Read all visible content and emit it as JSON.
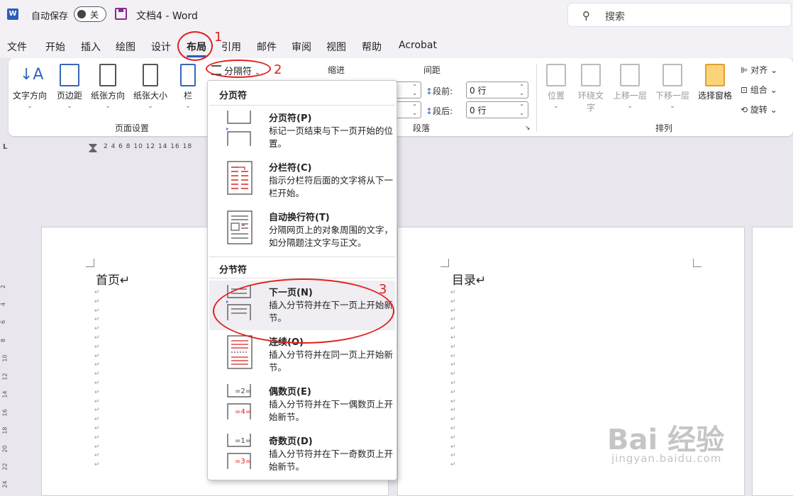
{
  "titlebar": {
    "autosave_label": "自动保存",
    "autosave_state": "关",
    "doc_title": "文档4  -  Word",
    "search_placeholder": "搜索"
  },
  "tabs": [
    "文件",
    "开始",
    "插入",
    "绘图",
    "设计",
    "布局",
    "引用",
    "邮件",
    "审阅",
    "视图",
    "帮助",
    "Acrobat"
  ],
  "active_tab": "布局",
  "ribbon": {
    "page_setup": {
      "group_label": "页面设置",
      "buttons": [
        "文字方向",
        "页边距",
        "纸张方向",
        "纸张大小",
        "栏"
      ],
      "breaks_button": "分隔符"
    },
    "paragraph": {
      "group_label": "段落",
      "indent_label": "缩进",
      "spacing_label": "间距",
      "before_label": "段前:",
      "before_value": "0 行",
      "after_label": "段后:",
      "after_value": "0 行"
    },
    "arrange": {
      "group_label": "排列",
      "buttons": [
        "位置",
        "环绕文字",
        "上移一层",
        "下移一层",
        "选择窗格"
      ],
      "right_items": [
        "对齐",
        "组合",
        "旋转"
      ]
    }
  },
  "ruler": {
    "h_numbers": "2  4  6  8 10 12 14 16 18",
    "v_numbers": [
      "2",
      "4",
      "6",
      "8",
      "10",
      "12",
      "14",
      "16",
      "18",
      "20",
      "22",
      "24"
    ]
  },
  "pages": {
    "left_text": "首页↵",
    "right_text": "目录↵"
  },
  "menu": {
    "page_breaks_header": "分页符",
    "section_breaks_header": "分节符",
    "items": [
      {
        "title": "分页符(P)",
        "desc": "标记一页结束与下一页开始的位置。"
      },
      {
        "title": "分栏符(C)",
        "desc": "指示分栏符后面的文字将从下一栏开始。"
      },
      {
        "title": "自动换行符(T)",
        "desc": "分隔网页上的对象周围的文字，如分隔题注文字与正文。"
      },
      {
        "title": "下一页(N)",
        "desc": "插入分节符并在下一页上开始新节。"
      },
      {
        "title": "连续(O)",
        "desc": "插入分节符并在同一页上开始新节。"
      },
      {
        "title": "偶数页(E)",
        "desc": "插入分节符并在下一偶数页上开始新节。"
      },
      {
        "title": "奇数页(D)",
        "desc": "插入分节符并在下一奇数页上开始新节。"
      }
    ]
  },
  "annotations": [
    "1",
    "2",
    "3"
  ],
  "watermark": {
    "brand": "Bai 经验",
    "url": "jingyan.baidu.com"
  },
  "colors": {
    "accent": "#2b5cb8",
    "annotation": "#e02020",
    "save_icon": "#8a2b8e"
  }
}
